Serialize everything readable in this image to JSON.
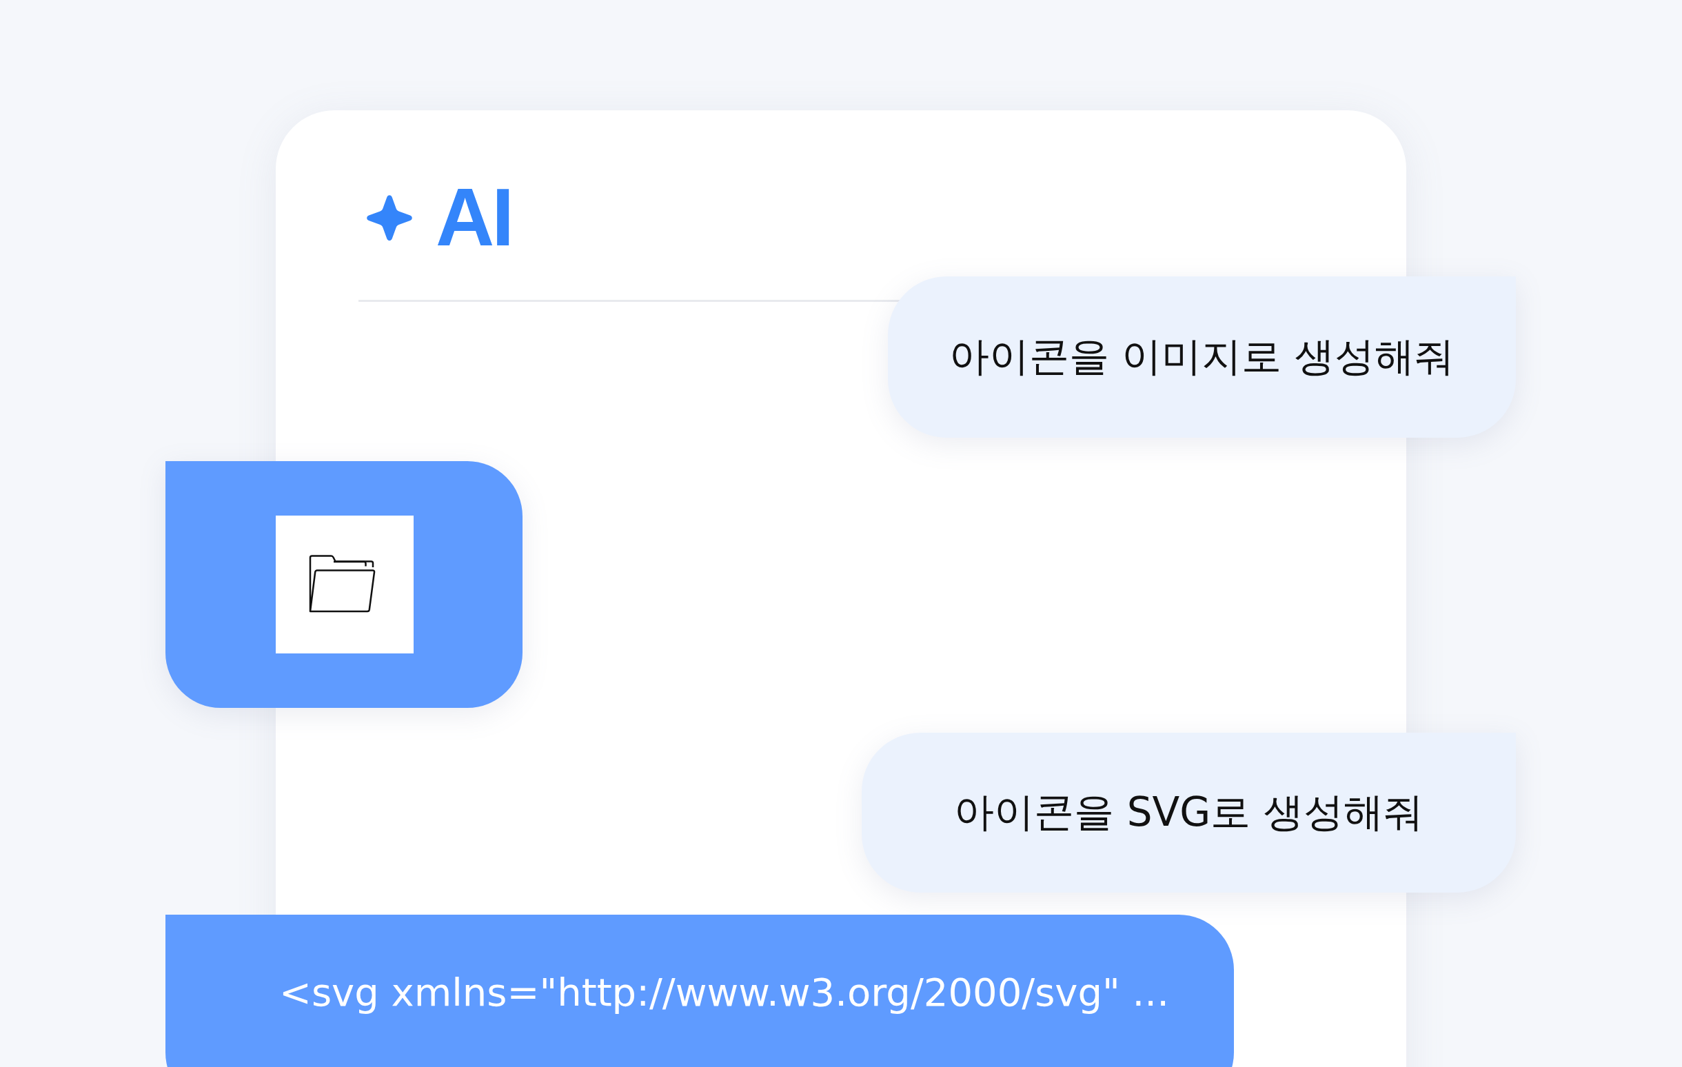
{
  "header": {
    "title": "AI"
  },
  "messages": [
    {
      "kind": "user",
      "text": "아이콘을 이미지로 생성해줘"
    },
    {
      "kind": "image"
    },
    {
      "kind": "user",
      "text": "아이콘을 SVG로 생성해줘"
    },
    {
      "kind": "code",
      "text": "<svg xmlns=\"http://www.w3.org/2000/svg\" ..."
    }
  ]
}
